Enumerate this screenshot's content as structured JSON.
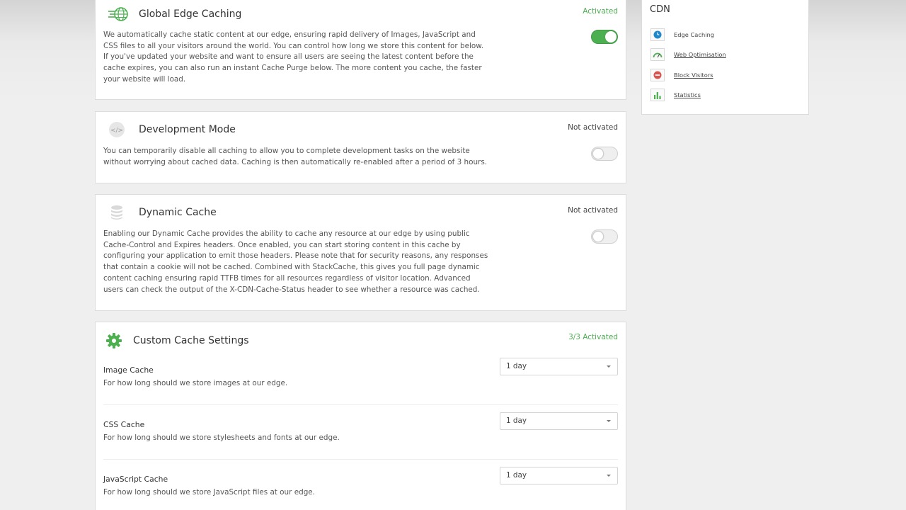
{
  "cards": {
    "edge": {
      "title": "Global Edge Caching",
      "status": "Activated",
      "toggle_on": true,
      "description": "We automatically cache static content at our edge, ensuring rapid delivery of Images, JavaScript and CSS files to all your visitors around the world. You can control how long we store this content for below. If you've updated your website and want to ensure all users are seeing the latest content before the cache expires, you can also run an instant Cache Purge below. The more content you cache, the faster your website will load."
    },
    "devmode": {
      "title": "Development Mode",
      "status": "Not activated",
      "toggle_on": false,
      "description": "You can temporarily disable all caching to allow you to complete development tasks on the website without worrying about cached data. Caching is then automatically re-enabled after a period of 3 hours."
    },
    "dynamic": {
      "title": "Dynamic Cache",
      "status": "Not activated",
      "toggle_on": false,
      "description": "Enabling our Dynamic Cache provides the ability to cache any resource at our edge by using public Cache-Control and Expires headers. Once enabled, you can start storing content in this cache by configuring your application to emit those headers. Please note that for security reasons, any responses that contain a cookie will not be cached. Combined with StackCache, this gives you full page dynamic content caching ensuring rapid TTFB times for all resources regardless of visitor location. Advanced users can check the output of the X-CDN-Cache-Status header to see whether a resource was cached."
    },
    "custom": {
      "title": "Custom Cache Settings",
      "status": "3/3 Activated",
      "settings": [
        {
          "name": "Image Cache",
          "description": "For how long should we store images at our edge.",
          "value": "1 day"
        },
        {
          "name": "CSS Cache",
          "description": "For how long should we store stylesheets and fonts at our edge.",
          "value": "1 day"
        },
        {
          "name": "JavaScript Cache",
          "description": "For how long should we store JavaScript files at our edge.",
          "value": "1 day"
        }
      ]
    }
  },
  "sidebar": {
    "title": "CDN",
    "items": [
      {
        "label": "Edge Caching",
        "icon": "clock-icon"
      },
      {
        "label": "Web Optimisation",
        "icon": "speedometer-icon"
      },
      {
        "label": "Block Visitors",
        "icon": "block-icon"
      },
      {
        "label": "Statistics",
        "icon": "bar-chart-icon"
      }
    ]
  },
  "colors": {
    "accent_green": "#4caf50",
    "block_red": "#d9534f",
    "clock_blue": "#1e88c9"
  }
}
